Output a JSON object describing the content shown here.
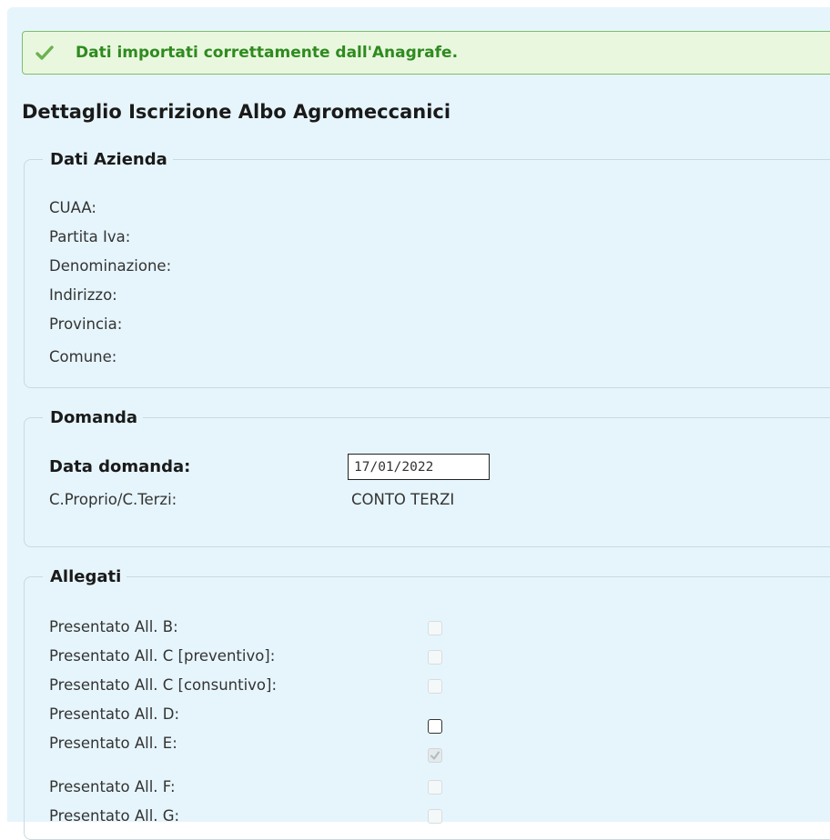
{
  "alert": {
    "message": "Dati importati correttamente dall'Anagrafe.",
    "icon": "check-icon",
    "color": "#2e8b1f"
  },
  "page_title": "Dettaglio Iscrizione Albo Agromeccanici",
  "azienda": {
    "legend": "Dati Azienda",
    "fields": [
      {
        "label": "CUAA:"
      },
      {
        "label": "Partita Iva:"
      },
      {
        "label": "Denominazione:"
      },
      {
        "label": "Indirizzo:"
      },
      {
        "label": "Provincia:"
      },
      {
        "label": "Comune:"
      }
    ]
  },
  "domanda": {
    "legend": "Domanda",
    "data_label": "Data domanda:",
    "data_value": "17/01/2022",
    "conto_label": "C.Proprio/C.Terzi:",
    "conto_value": "CONTO TERZI"
  },
  "allegati": {
    "legend": "Allegati",
    "items": [
      {
        "label": "Presentato All. B:",
        "checked": false,
        "disabled": true
      },
      {
        "label": "Presentato All. C [preventivo]:",
        "checked": false,
        "disabled": true
      },
      {
        "label": "Presentato All. C [consuntivo]:",
        "checked": false,
        "disabled": true
      },
      {
        "label": "Presentato All. D:",
        "checked": false,
        "disabled": false
      },
      {
        "label": "Presentato All. E:",
        "checked": true,
        "disabled": true
      },
      {
        "label": "Presentato All. F:",
        "checked": false,
        "disabled": true
      },
      {
        "label": "Presentato All. G:",
        "checked": false,
        "disabled": true
      }
    ]
  }
}
